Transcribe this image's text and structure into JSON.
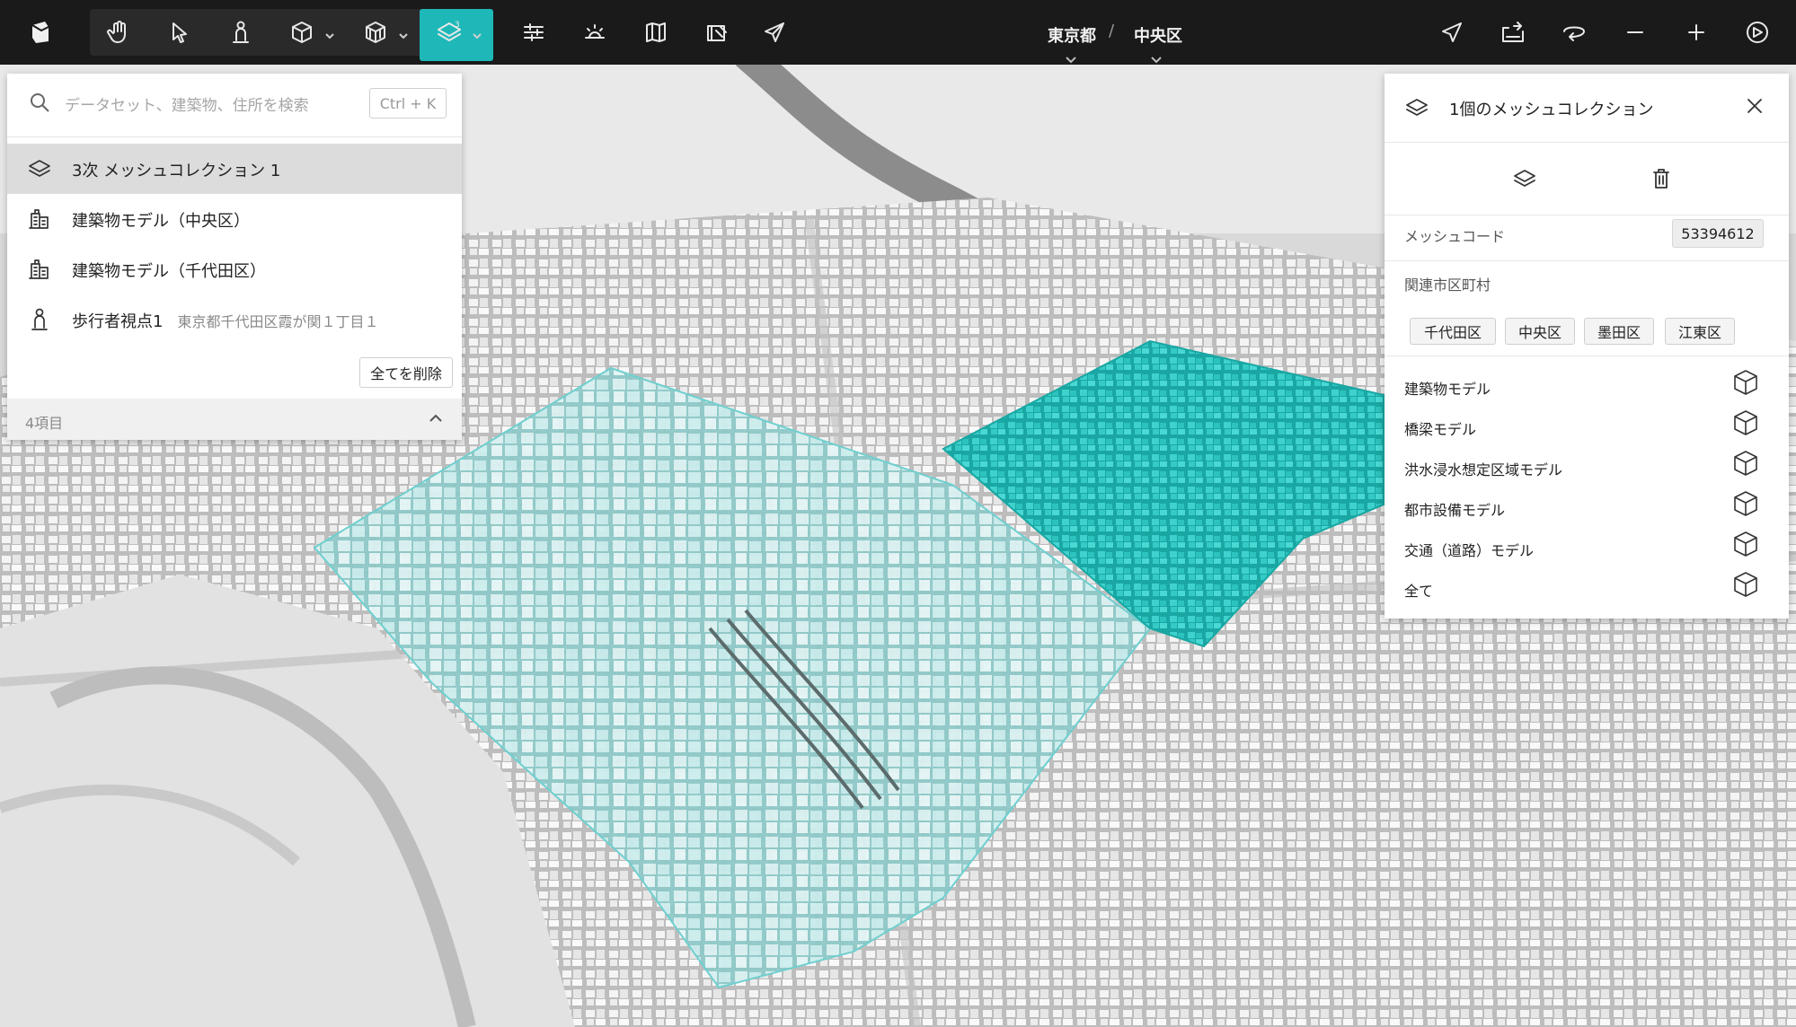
{
  "breadcrumb": {
    "prefecture": "東京都",
    "separator": "/",
    "ward": "中央区"
  },
  "toolbar": {
    "left_icons": [
      "app-logo-icon",
      "hand-icon",
      "pointer-icon",
      "pedestrian-icon",
      "box-icon",
      "building-box-icon",
      "mesh-layers-icon"
    ],
    "right_icons": [
      "filter-sliders-icon",
      "sun-horizon-icon",
      "map-book-icon",
      "story-icon",
      "send-icon"
    ],
    "end_icons": [
      "locate-arrow-icon",
      "screenshot-icon",
      "rotate-icon",
      "zoom-out-icon",
      "zoom-in-icon",
      "compass-icon"
    ],
    "active_color": "#1fb8b8"
  },
  "search": {
    "placeholder": "データセット、建築物、住所を検索",
    "shortcut": "Ctrl + K"
  },
  "datasets": [
    {
      "label": "3次 メッシュコレクション 1",
      "sub": "",
      "icon": "mesh-layers-icon"
    },
    {
      "label": "建築物モデル（中央区）",
      "sub": "",
      "icon": "building-model-icon"
    },
    {
      "label": "建築物モデル（千代田区）",
      "sub": "",
      "icon": "building-model-icon"
    },
    {
      "label": "歩行者視点1",
      "sub": "東京都千代田区霞が関１丁目１",
      "icon": "pedestrian-icon"
    }
  ],
  "delete_all_label": "全てを削除",
  "item_count": "4項目",
  "inspector": {
    "title": "1個のメッシュコレクション",
    "mesh_code_label": "メッシュコード",
    "mesh_code": "53394612",
    "municipality_label": "関連市区町村",
    "municipalities": [
      "千代田区",
      "中央区",
      "墨田区",
      "江東区"
    ],
    "models": [
      "建築物モデル",
      "橋梁モデル",
      "洪水浸水想定区域モデル",
      "都市設備モデル",
      "交通（道路）モデル",
      "全て"
    ]
  },
  "colors": {
    "highlight": "#2ec4c0",
    "highlight_light": "#a8e6e6",
    "water": "#8a8a8a"
  }
}
